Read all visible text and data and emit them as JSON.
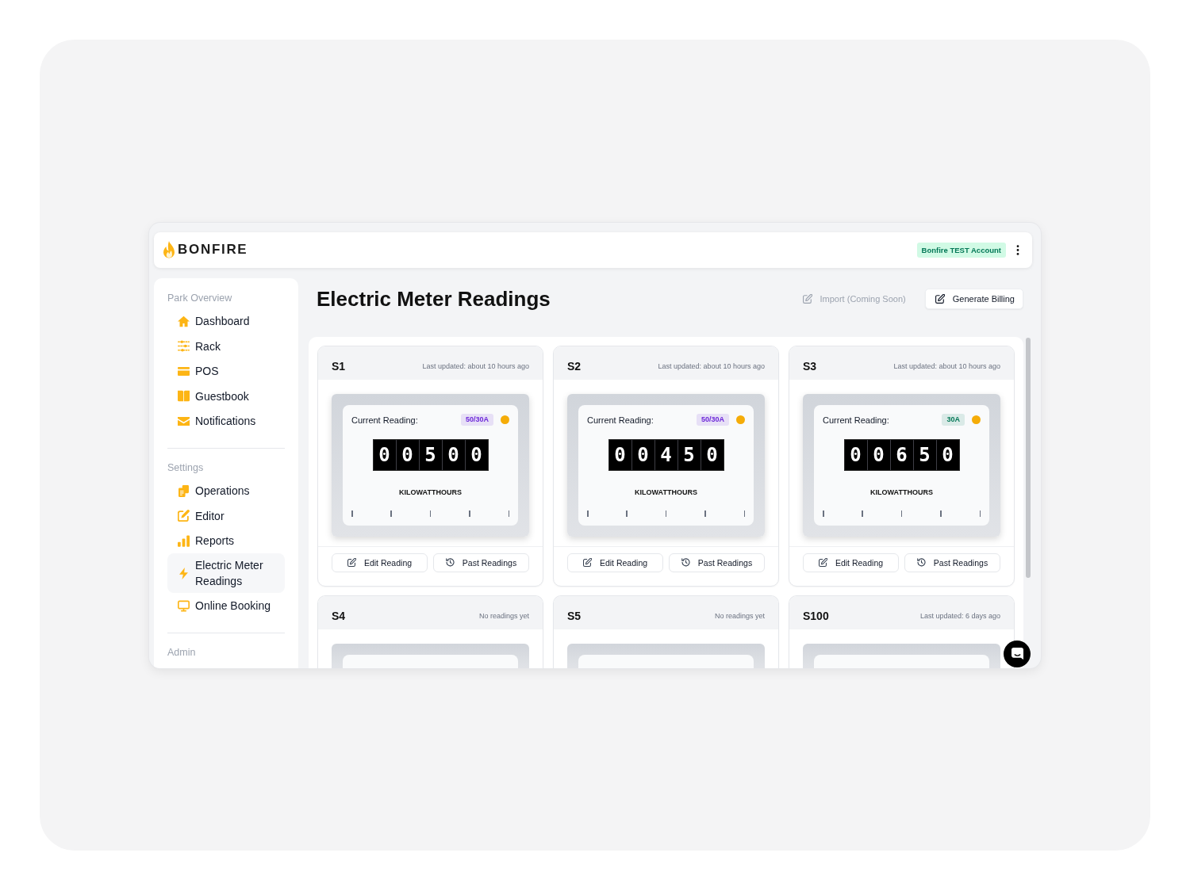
{
  "header": {
    "logo": "BONFIRE",
    "account": "Bonfire TEST Account"
  },
  "sidebar": {
    "sections": [
      {
        "title": "Park Overview",
        "items": [
          {
            "label": "Dashboard",
            "selected": false
          },
          {
            "label": "Rack",
            "selected": false
          },
          {
            "label": "POS",
            "selected": false
          },
          {
            "label": "Guestbook",
            "selected": false
          },
          {
            "label": "Notifications",
            "selected": false
          }
        ]
      },
      {
        "title": "Settings",
        "items": [
          {
            "label": "Operations",
            "selected": false
          },
          {
            "label": "Editor",
            "selected": false
          },
          {
            "label": "Reports",
            "selected": false
          },
          {
            "label": "Electric Meter Readings",
            "selected": true
          },
          {
            "label": "Online Booking",
            "selected": false
          }
        ]
      },
      {
        "title": "Admin"
      }
    ]
  },
  "page": {
    "title": "Electric Meter Readings",
    "actions": [
      {
        "label": "Import (Coming Soon)",
        "disabled": true
      },
      {
        "label": "Generate Billing",
        "disabled": false
      }
    ]
  },
  "meters": [
    {
      "name": "S1",
      "updated": "Last updated: about 10 hours ago",
      "reading_label": "Current Reading:",
      "badge": {
        "text": "50/30A",
        "color": "#6d28d9"
      },
      "digits": [
        "0",
        "0",
        "5",
        "0",
        "0"
      ],
      "unit": "KILOWATTHOURS",
      "buttons": [
        "Edit Reading",
        "Past Readings"
      ]
    },
    {
      "name": "S2",
      "updated": "Last updated: about 10 hours ago",
      "reading_label": "Current Reading:",
      "badge": {
        "text": "50/30A",
        "color": "#6d28d9"
      },
      "digits": [
        "0",
        "0",
        "4",
        "5",
        "0"
      ],
      "unit": "KILOWATTHOURS",
      "buttons": [
        "Edit Reading",
        "Past Readings"
      ]
    },
    {
      "name": "S3",
      "updated": "Last updated: about 10 hours ago",
      "reading_label": "Current Reading:",
      "badge": {
        "text": "30A",
        "color": "#047857"
      },
      "digits": [
        "0",
        "0",
        "6",
        "5",
        "0"
      ],
      "unit": "KILOWATTHOURS",
      "buttons": [
        "Edit Reading",
        "Past Readings"
      ]
    },
    {
      "name": "S4",
      "updated": "No readings yet"
    },
    {
      "name": "S5",
      "updated": "No readings yet"
    },
    {
      "name": "S100",
      "updated": "Last updated: 6 days ago"
    }
  ]
}
